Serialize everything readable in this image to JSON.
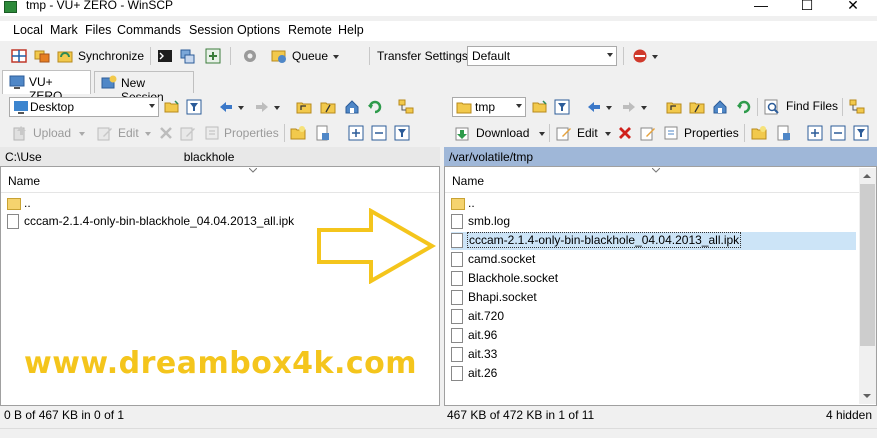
{
  "window": {
    "title": "tmp - VU+ ZERO - WinSCP"
  },
  "menu": [
    "Local",
    "Mark",
    "Files",
    "Commands",
    "Session",
    "Options",
    "Remote",
    "Help"
  ],
  "toolbar": {
    "synchronize_label": "Synchronize",
    "queue_label": "Queue",
    "transfer_settings_label": "Transfer Settings",
    "transfer_settings_value": "Default"
  },
  "tabs": [
    {
      "label": "VU+ ZERO",
      "active": true
    },
    {
      "label": "New Session",
      "active": false
    }
  ],
  "local": {
    "location": "Desktop",
    "actions": {
      "upload": "Upload",
      "edit": "Edit",
      "properties": "Properties"
    },
    "path_start": "C:\\Use",
    "path_end": "blackhole",
    "column_name": "Name",
    "files": [
      {
        "name": "..",
        "type": "parent"
      },
      {
        "name": "cccam-2.1.4-only-bin-blackhole_04.04.2013_all.ipk",
        "type": "file"
      }
    ],
    "status": "0 B of 467 KB in 0 of 1"
  },
  "remote": {
    "location": "tmp",
    "find_files_label": "Find Files",
    "actions": {
      "download": "Download",
      "edit": "Edit",
      "properties": "Properties"
    },
    "path": "/var/volatile/tmp",
    "column_name": "Name",
    "files": [
      {
        "name": "..",
        "type": "parent"
      },
      {
        "name": "smb.log",
        "type": "file"
      },
      {
        "name": "cccam-2.1.4-only-bin-blackhole_04.04.2013_all.ipk",
        "type": "file",
        "selected": true
      },
      {
        "name": "camd.socket",
        "type": "file"
      },
      {
        "name": "Blackhole.socket",
        "type": "file"
      },
      {
        "name": "Bhapi.socket",
        "type": "file"
      },
      {
        "name": "ait.720",
        "type": "file"
      },
      {
        "name": "ait.96",
        "type": "file"
      },
      {
        "name": "ait.33",
        "type": "file"
      },
      {
        "name": "ait.26",
        "type": "file"
      }
    ],
    "status": "467 KB of 472 KB in 1 of 11",
    "hidden_status": "4 hidden"
  },
  "overlay": {
    "watermark": "www.dreambox4k.com"
  },
  "colors": {
    "accent_yellow": "#f4c51c",
    "selection": "#cce4f7",
    "path_header": "#e8e8e8"
  }
}
